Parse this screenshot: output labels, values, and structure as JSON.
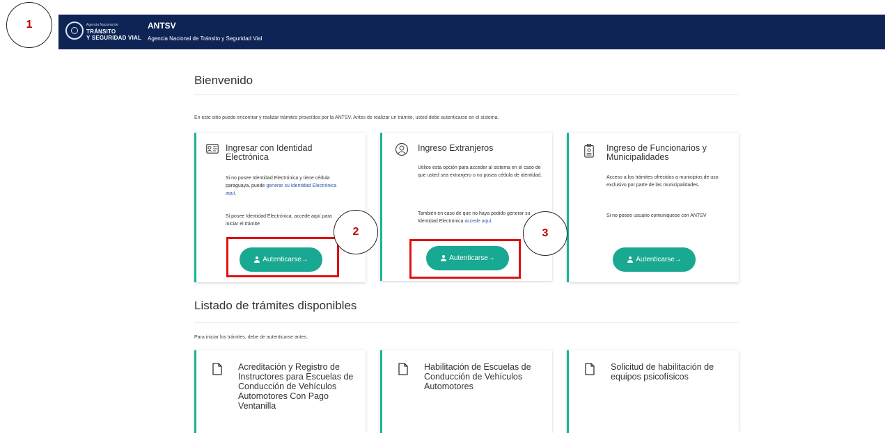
{
  "header": {
    "logo_small": "Agencia Nacional de",
    "logo_line1": "TRÁNSITO",
    "logo_line2": "Y SEGURIDAD VIAL",
    "title": "ANTSV",
    "subtitle": "Agencia Nacional de Tránsito y Seguridad Vial"
  },
  "callouts": [
    "1",
    "2",
    "3"
  ],
  "welcome": {
    "title": "Bienvenido",
    "intro": "En este sitio puede encontrar y realizar trámites proveídos por la ANTSV. Antes de realizar un trámite, usted debe autenticarse en el sistema."
  },
  "login_cards": [
    {
      "icon": "id-card-icon",
      "title": "Ingresar con Identidad Electrónica",
      "p1_before": "Si no posee Identidad Electrónica y tiene cédula paraguaya, puede ",
      "p1_link": "generar su Identidad Electrónica aquí",
      "p1_after": ".",
      "p2": "Si posee Identidad Electrónica, accede aquí para iniciar el trámite",
      "button": "Autenticarse→"
    },
    {
      "icon": "globe-user-icon",
      "title": "Ingreso Extranjeros",
      "p1": "Utilice esta opción para acceder al sistema en el caso de que usted sea extranjero o no posea cédula de identidad.",
      "p2_before": "También en caso de que no haya podido generar su Identidad Electrónica ",
      "p2_link": "accede aquí",
      "p2_after": ".",
      "button": "Autenticarse→"
    },
    {
      "icon": "badge-icon",
      "title": "Ingreso de Funcionarios y Municipalidades",
      "p1": "Acceso a los trámites ofrecidos a municipios de uso exclusivo por parte de las municipalidades.",
      "p2": "Si no posee usuario comuniquese con ANTSV",
      "button": "Autenticarse→"
    }
  ],
  "tramites": {
    "title": "Listado de trámites disponibles",
    "intro": "Para iniciar los trámites, debe de autenticarse antes.",
    "items": [
      "Acreditación y Registro de Instructores para Escuelas de Conducción de Vehículos Automotores Con Pago Ventanilla",
      "Habilitación de Escuelas de Conducción de Vehículos Automotores",
      "Solicitud de habilitación de equipos psicofísicos"
    ]
  },
  "colors": {
    "header_bg": "#0d2455",
    "accent": "#19a891",
    "highlight": "#e01010",
    "link": "#2b56a8"
  }
}
